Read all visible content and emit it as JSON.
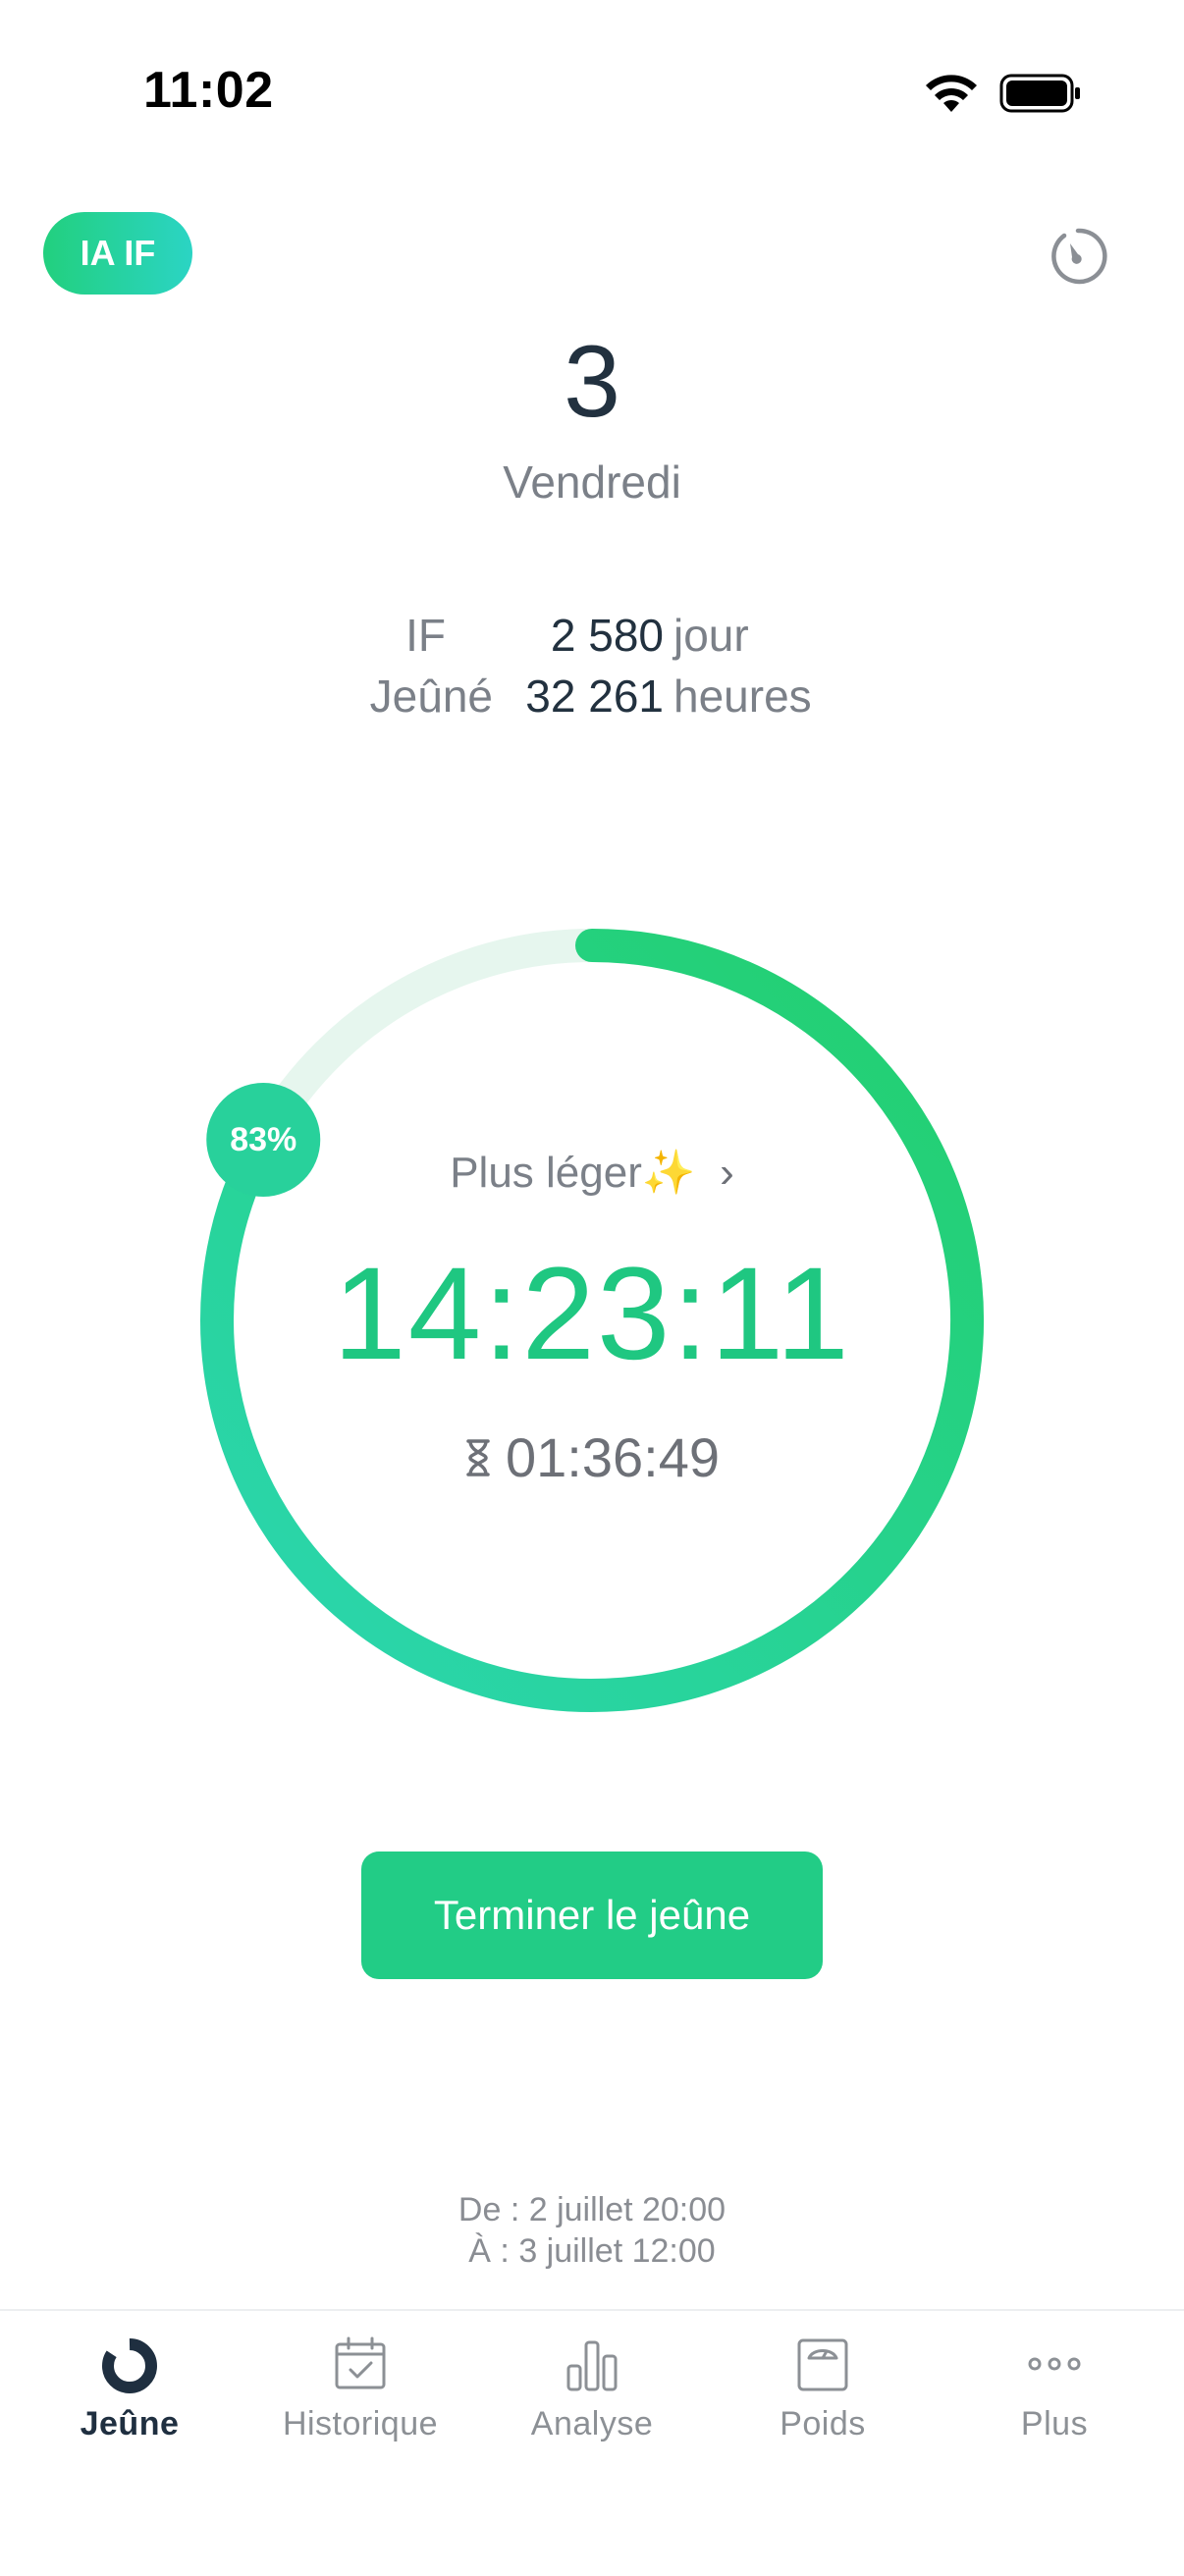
{
  "status_bar": {
    "time": "11:02"
  },
  "header": {
    "badge_label": "IA IF",
    "day_number": "3",
    "day_name": "Vendredi"
  },
  "stats": [
    {
      "label": "IF",
      "value": "2 580",
      "unit": "jour"
    },
    {
      "label": "Jeûné",
      "value": "32 261",
      "unit": "heures"
    }
  ],
  "timer": {
    "progress_percent": 83,
    "progress_label": "83%",
    "caption": "Plus léger✨",
    "elapsed": "14:23:11",
    "remaining": "01:36:49"
  },
  "actions": {
    "end_fast_label": "Terminer le jeûne"
  },
  "schedule": {
    "from": "De : 2 juillet 20:00",
    "to": "À : 3 juillet 12:00"
  },
  "tab_bar": {
    "tabs": [
      {
        "label": "Jeûne",
        "icon": "fast-ring-icon",
        "active": true
      },
      {
        "label": "Historique",
        "icon": "calendar-check-icon",
        "active": false
      },
      {
        "label": "Analyse",
        "icon": "bar-chart-icon",
        "active": false
      },
      {
        "label": "Poids",
        "icon": "scale-icon",
        "active": false
      },
      {
        "label": "Plus",
        "icon": "more-dots-icon",
        "active": false
      }
    ]
  },
  "colors": {
    "accent_green": "#22cc86",
    "accent_teal": "#2bd4b4",
    "text_dark": "#22313f",
    "text_muted": "#7b8088"
  }
}
